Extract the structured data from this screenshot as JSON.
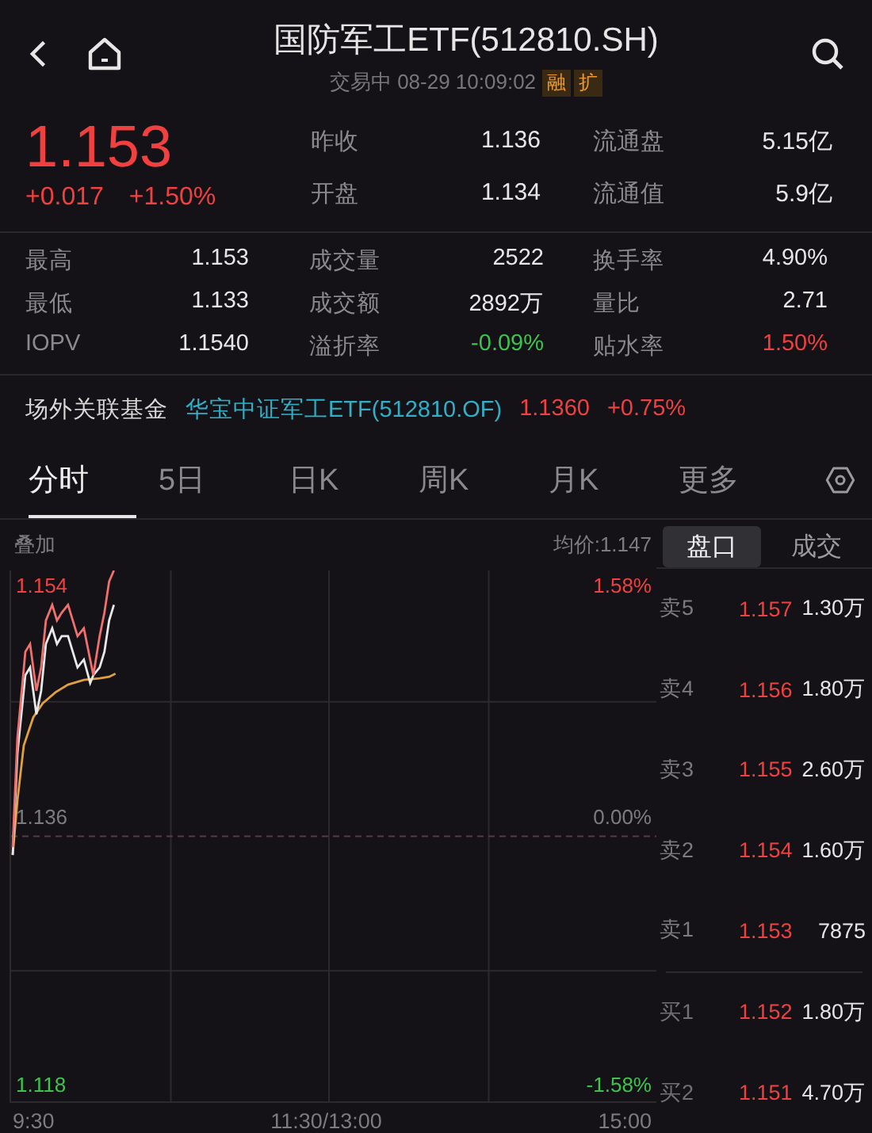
{
  "header": {
    "title": "国防军工ETF(512810.SH)",
    "status": "交易中 08-29 10:09:02",
    "tags": [
      "融",
      "扩"
    ]
  },
  "quote": {
    "price": "1.153",
    "change": "+0.017",
    "change_pct": "+1.50%",
    "color": "#f0403f",
    "stats": [
      {
        "label": "昨收",
        "value": "1.136"
      },
      {
        "label": "流通盘",
        "value": "5.15亿"
      },
      {
        "label": "开盘",
        "value": "1.134"
      },
      {
        "label": "流通值",
        "value": "5.9亿"
      }
    ]
  },
  "stats": [
    {
      "label": "最高",
      "value": "1.153",
      "color": "#e6e6e6"
    },
    {
      "label": "成交量",
      "value": "2522",
      "color": "#e6e6e6"
    },
    {
      "label": "换手率",
      "value": "4.90%",
      "color": "#e6e6e6"
    },
    {
      "label": "最低",
      "value": "1.133",
      "color": "#e6e6e6"
    },
    {
      "label": "成交额",
      "value": "2892万",
      "color": "#e6e6e6"
    },
    {
      "label": "量比",
      "value": "2.71",
      "color": "#e6e6e6"
    },
    {
      "label": "IOPV",
      "value": "1.1540",
      "color": "#e6e6e6"
    },
    {
      "label": "溢折率",
      "value": "-0.09%",
      "color": "#3cc44f"
    },
    {
      "label": "贴水率",
      "value": "1.50%",
      "color": "#f0403f"
    }
  ],
  "fund": {
    "label": "场外关联基金",
    "name": "华宝中证军工ETF(512810.OF)",
    "price": "1.1360",
    "change_pct": "+0.75%",
    "color": "#f0403f"
  },
  "tabs": [
    {
      "label": "分时",
      "selected": true
    },
    {
      "label": "5日",
      "selected": false
    },
    {
      "label": "日K",
      "selected": false
    },
    {
      "label": "周K",
      "selected": false
    },
    {
      "label": "月K",
      "selected": false
    },
    {
      "label": "更多",
      "selected": false
    }
  ],
  "chart": {
    "overlay": "叠加",
    "average": "均价:1.147",
    "price_high": "1.154",
    "pct_high": "1.58%",
    "price_mid": "1.136",
    "pct_mid": "0.00%",
    "price_low": "1.118",
    "pct_low": "-1.58%",
    "times": [
      "9:30",
      "11:30/13:00",
      "15:00"
    ]
  },
  "book_tabs": [
    {
      "label": "盘口",
      "selected": true
    },
    {
      "label": "成交",
      "selected": false
    }
  ],
  "book": [
    {
      "kind": "sell",
      "label": "卖5",
      "price": "1.157",
      "volume": "1.30万"
    },
    {
      "kind": "sell",
      "label": "卖4",
      "price": "1.156",
      "volume": "1.80万"
    },
    {
      "kind": "sell",
      "label": "卖3",
      "price": "1.155",
      "volume": "2.60万"
    },
    {
      "kind": "sell",
      "label": "卖2",
      "price": "1.154",
      "volume": "1.60万"
    },
    {
      "kind": "sell",
      "label": "卖1",
      "price": "1.153",
      "volume": "7875"
    },
    {
      "kind": "buy",
      "label": "买1",
      "price": "1.152",
      "volume": "1.80万"
    },
    {
      "kind": "buy",
      "label": "买2",
      "price": "1.151",
      "volume": "4.70万"
    }
  ]
}
